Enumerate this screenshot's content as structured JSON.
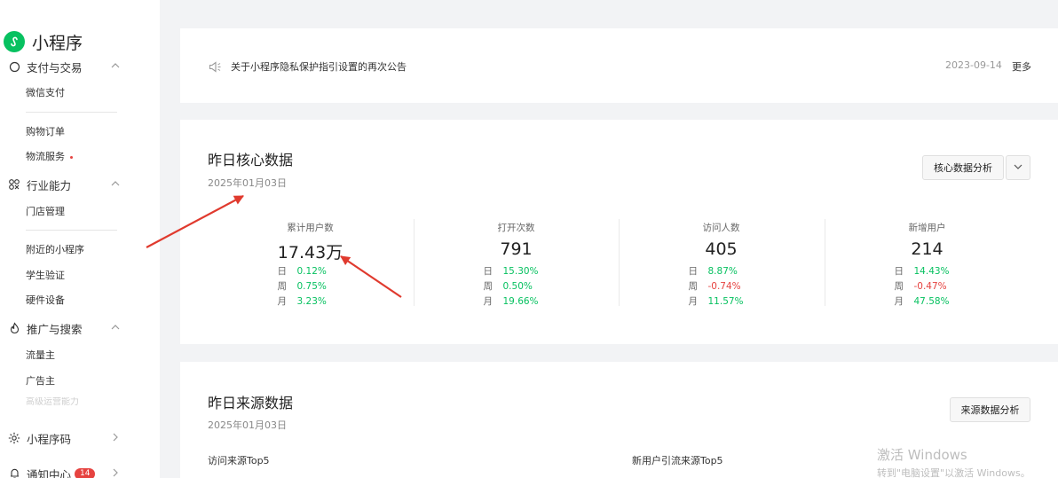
{
  "app": {
    "title": "小程序"
  },
  "sidebar": {
    "groups": [
      {
        "label": "支付与交易",
        "items": [
          "微信支付",
          "购物订单",
          "物流服务"
        ]
      },
      {
        "label": "行业能力",
        "items": [
          "门店管理",
          "附近的小程序",
          "学生验证",
          "硬件设备"
        ]
      },
      {
        "label": "推广与搜索",
        "items": [
          "流量主",
          "广告主",
          "高级运营能力"
        ]
      },
      {
        "label": "小程序码"
      },
      {
        "label": "通知中心",
        "badge": "14"
      }
    ]
  },
  "notice": {
    "text": "关于小程序隐私保护指引设置的再次公告",
    "date": "2023-09-14",
    "more": "更多"
  },
  "core": {
    "title": "昨日核心数据",
    "date": "2025年01月03日",
    "analysis_button": "核心数据分析",
    "metrics": [
      {
        "label": "累计用户数",
        "value": "17.43万",
        "rows": [
          {
            "k": "日",
            "v": "0.12%",
            "trend": "up"
          },
          {
            "k": "周",
            "v": "0.75%",
            "trend": "up"
          },
          {
            "k": "月",
            "v": "3.23%",
            "trend": "up"
          }
        ]
      },
      {
        "label": "打开次数",
        "value": "791",
        "rows": [
          {
            "k": "日",
            "v": "15.30%",
            "trend": "up"
          },
          {
            "k": "周",
            "v": "0.50%",
            "trend": "up"
          },
          {
            "k": "月",
            "v": "19.66%",
            "trend": "up"
          }
        ]
      },
      {
        "label": "访问人数",
        "value": "405",
        "rows": [
          {
            "k": "日",
            "v": "8.87%",
            "trend": "up"
          },
          {
            "k": "周",
            "v": "-0.74%",
            "trend": "down"
          },
          {
            "k": "月",
            "v": "11.57%",
            "trend": "up"
          }
        ]
      },
      {
        "label": "新增用户",
        "value": "214",
        "rows": [
          {
            "k": "日",
            "v": "14.43%",
            "trend": "up"
          },
          {
            "k": "周",
            "v": "-0.47%",
            "trend": "down"
          },
          {
            "k": "月",
            "v": "47.58%",
            "trend": "up"
          }
        ]
      }
    ]
  },
  "source": {
    "title": "昨日来源数据",
    "date": "2025年01月03日",
    "analysis_button": "来源数据分析",
    "top_visit": "访问来源Top5",
    "top_new": "新用户引流来源Top5"
  },
  "watermark": {
    "line1": "激活 Windows",
    "line2": "转到\"电脑设置\"以激活 Windows。"
  },
  "colors": {
    "brand": "#07c160",
    "up": "#07c160",
    "down": "#e64340",
    "annotation": "#e03a2e"
  }
}
